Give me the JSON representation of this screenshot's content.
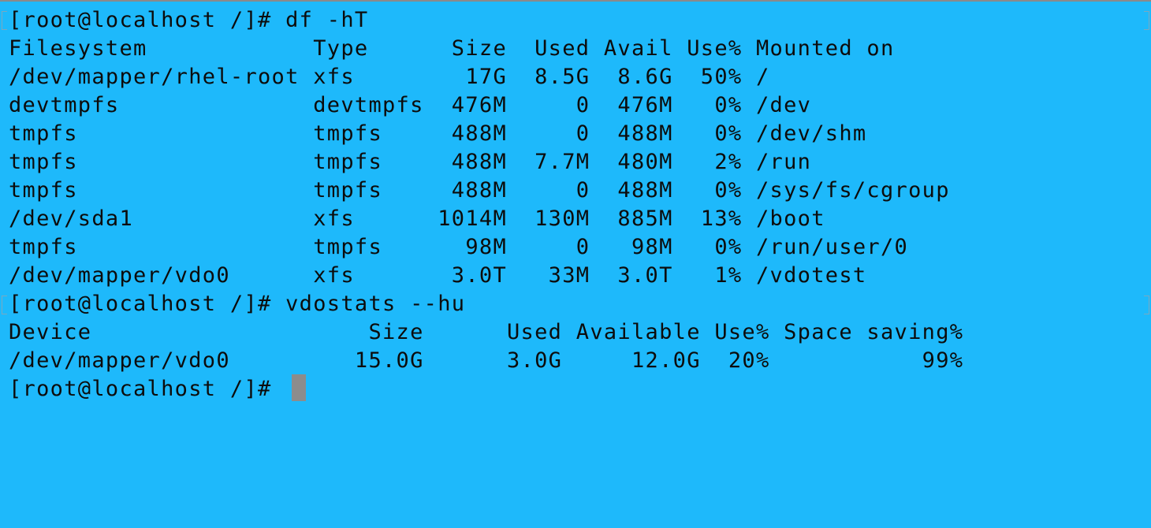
{
  "terminal": {
    "lines": [
      "[root@localhost /]# df -hT",
      "Filesystem            Type      Size  Used Avail Use% Mounted on",
      "/dev/mapper/rhel-root xfs        17G  8.5G  8.6G  50% /",
      "devtmpfs              devtmpfs  476M     0  476M   0% /dev",
      "tmpfs                 tmpfs     488M     0  488M   0% /dev/shm",
      "tmpfs                 tmpfs     488M  7.7M  480M   2% /run",
      "tmpfs                 tmpfs     488M     0  488M   0% /sys/fs/cgroup",
      "/dev/sda1             xfs      1014M  130M  885M  13% /boot",
      "tmpfs                 tmpfs      98M     0   98M   0% /run/user/0",
      "/dev/mapper/vdo0      xfs       3.0T   33M  3.0T   1% /vdotest",
      "[root@localhost /]# vdostats --hu",
      "Device                    Size      Used Available Use% Space saving%",
      "/dev/mapper/vdo0         15.0G      3.0G     12.0G  20%           99%",
      "[root@localhost /]# "
    ]
  },
  "colors": {
    "background": "#1eb9fb",
    "text": "#0c0c0c",
    "cursor": "#8c8c8c"
  }
}
